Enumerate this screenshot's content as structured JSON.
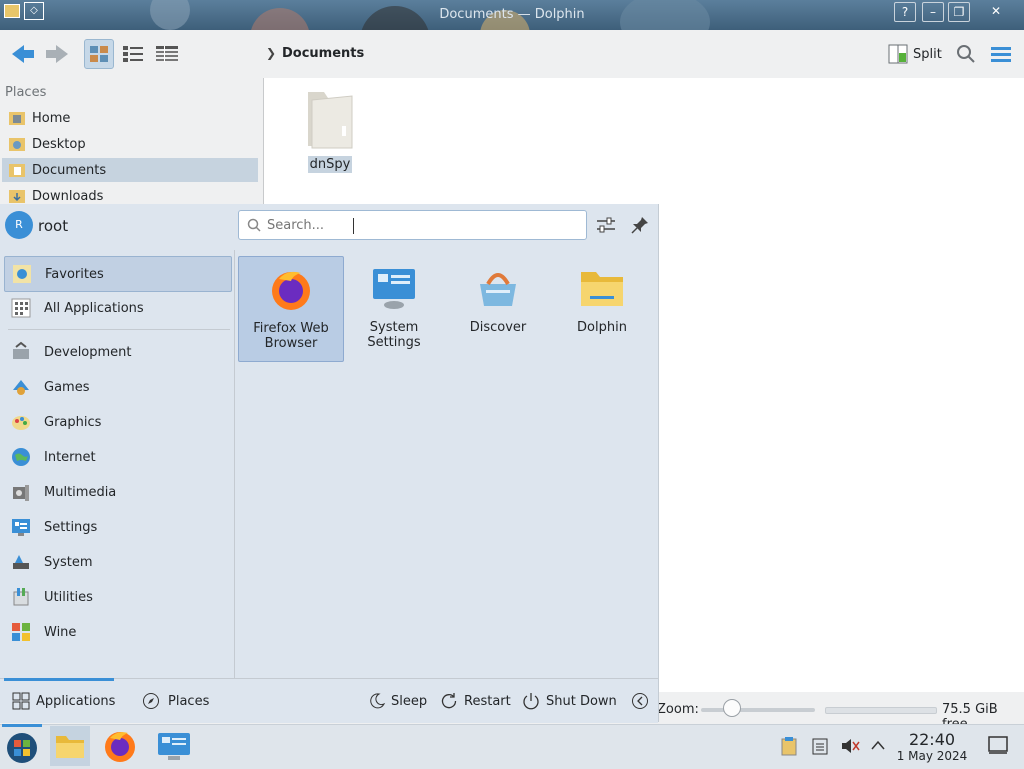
{
  "window": {
    "title": "Documents — Dolphin"
  },
  "toolbar": {
    "back_icon": "arrow-left-icon",
    "forward_icon": "arrow-right-icon",
    "breadcrumb": "Documents",
    "split_label": "Split"
  },
  "places": {
    "title": "Places",
    "items": [
      {
        "label": "Home"
      },
      {
        "label": "Desktop"
      },
      {
        "label": "Documents",
        "selected": true
      },
      {
        "label": "Downloads"
      }
    ]
  },
  "content": {
    "items": [
      {
        "label": "dnSpy",
        "icon": "folder-icon"
      }
    ]
  },
  "statusbar": {
    "zoom_label": "Zoom:",
    "free_space": "75.5 GiB free"
  },
  "launcher": {
    "user": {
      "initial": "R",
      "name": "root"
    },
    "search": {
      "placeholder": "Search..."
    },
    "categories": [
      {
        "label": "Favorites",
        "selected": true
      },
      {
        "label": "All Applications"
      },
      {
        "label": "Development"
      },
      {
        "label": "Games"
      },
      {
        "label": "Graphics"
      },
      {
        "label": "Internet"
      },
      {
        "label": "Multimedia"
      },
      {
        "label": "Settings"
      },
      {
        "label": "System"
      },
      {
        "label": "Utilities"
      },
      {
        "label": "Wine"
      }
    ],
    "apps": [
      {
        "label": "Firefox Web Browser",
        "selected": true
      },
      {
        "label": "System Settings"
      },
      {
        "label": "Discover"
      },
      {
        "label": "Dolphin"
      }
    ],
    "footer": {
      "applications": "Applications",
      "places": "Places",
      "sleep": "Sleep",
      "restart": "Restart",
      "shutdown": "Shut Down"
    }
  },
  "taskbar": {
    "time": "22:40",
    "date": "1 May 2024"
  }
}
